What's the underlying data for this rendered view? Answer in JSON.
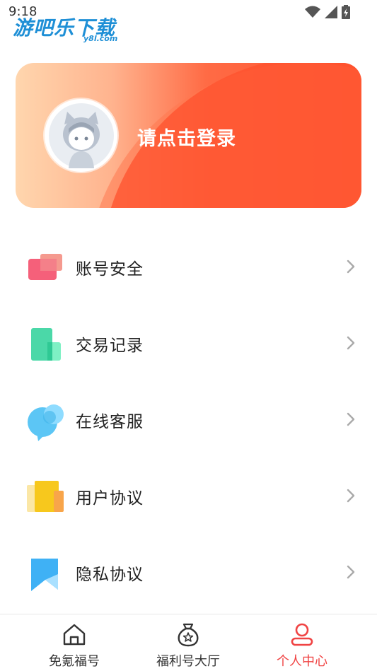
{
  "status_bar": {
    "time": "9:18"
  },
  "watermark": {
    "brand": "游吧乐下载",
    "domain": "y8l.com"
  },
  "profile_card": {
    "login_prompt": "请点击登录"
  },
  "menu": {
    "items": [
      {
        "label": "账号安全",
        "icon": "account-security-icon"
      },
      {
        "label": "交易记录",
        "icon": "transaction-record-icon"
      },
      {
        "label": "在线客服",
        "icon": "chat-bubble-icon"
      },
      {
        "label": "用户协议",
        "icon": "document-icon"
      },
      {
        "label": "隐私协议",
        "icon": "bookmark-icon"
      }
    ]
  },
  "tabbar": {
    "tabs": [
      {
        "label": "免氪福号",
        "icon": "home-icon",
        "active": false
      },
      {
        "label": "福利号大厅",
        "icon": "money-bag-icon",
        "active": false
      },
      {
        "label": "个人中心",
        "icon": "user-icon",
        "active": true
      }
    ]
  },
  "colors": {
    "accent": "#ff5330",
    "active_tab": "#f04444",
    "card_gradient_start": "#ffd6ae"
  }
}
